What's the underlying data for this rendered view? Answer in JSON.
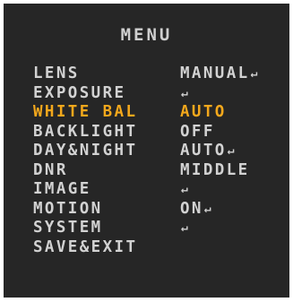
{
  "menu": {
    "title": "MENU",
    "selected_color": "#f4a81c",
    "text_color": "#d2d2d2",
    "background_color": "#262626",
    "enter_icon_glyph": "↵",
    "items": [
      {
        "label": "LENS",
        "value": "MANUAL",
        "enter": true,
        "selected": false
      },
      {
        "label": "EXPOSURE",
        "value": "",
        "enter": true,
        "selected": false
      },
      {
        "label": "WHITE BAL",
        "value": "AUTO",
        "enter": false,
        "selected": true
      },
      {
        "label": "BACKLIGHT",
        "value": "OFF",
        "enter": false,
        "selected": false
      },
      {
        "label": "DAY&NIGHT",
        "value": "AUTO",
        "enter": true,
        "selected": false
      },
      {
        "label": "DNR",
        "value": "MIDDLE",
        "enter": false,
        "selected": false
      },
      {
        "label": "IMAGE",
        "value": "",
        "enter": true,
        "selected": false
      },
      {
        "label": "MOTION",
        "value": "ON",
        "enter": true,
        "selected": false
      },
      {
        "label": "SYSTEM",
        "value": "",
        "enter": true,
        "selected": false
      },
      {
        "label": "SAVE&EXIT",
        "value": "",
        "enter": false,
        "selected": false
      }
    ]
  }
}
